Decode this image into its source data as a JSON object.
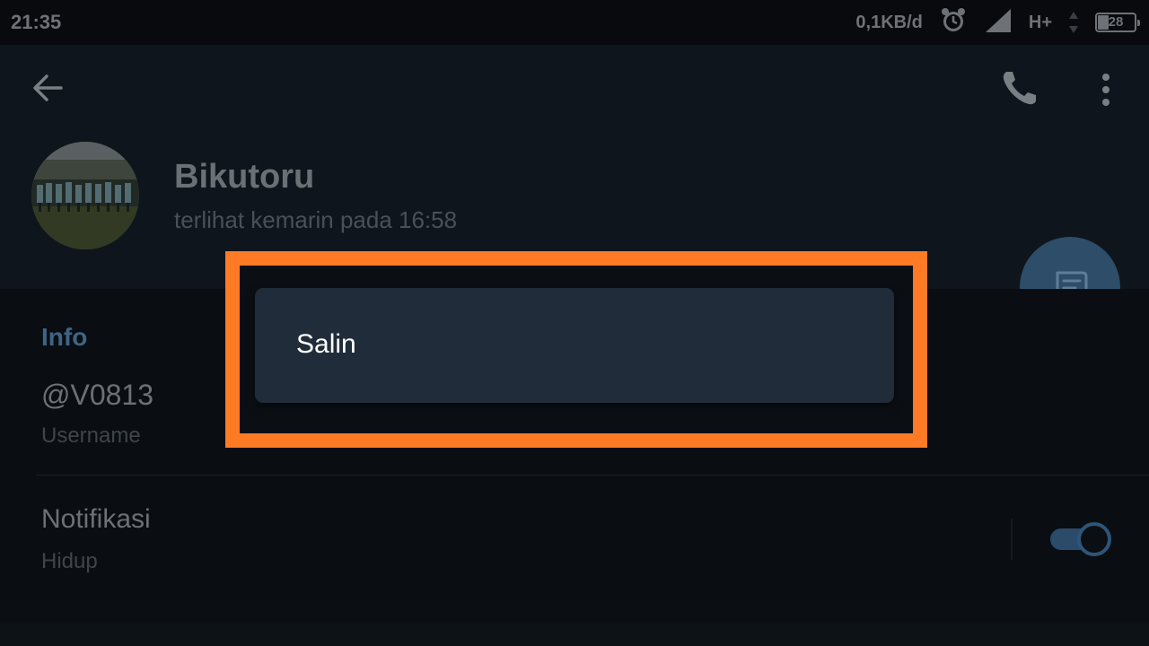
{
  "status_bar": {
    "time": "21:35",
    "network_speed": "0,1KB/d",
    "network_type": "H+",
    "battery_level": "28",
    "icons": [
      "alarm-icon",
      "signal-icon",
      "data-arrows-icon",
      "battery-icon"
    ]
  },
  "header": {
    "back_icon": "arrow-left-icon",
    "call_icon": "phone-icon",
    "more_icon": "more-vertical-icon",
    "name": "Bikutoru",
    "last_seen": "terlihat kemarin pada  16:58"
  },
  "fab": {
    "icon": "message-icon"
  },
  "info": {
    "section_title": "Info",
    "username_value": "@V0813",
    "username_label": "Username",
    "notifications_value": "Notifikasi",
    "notifications_label": "Hidup",
    "notifications_enabled": true
  },
  "context_menu": {
    "items": [
      {
        "label": "Salin"
      }
    ]
  },
  "colors": {
    "highlight": "#ff7a24",
    "accent": "#3f6485",
    "popup_bg": "#202c39"
  }
}
